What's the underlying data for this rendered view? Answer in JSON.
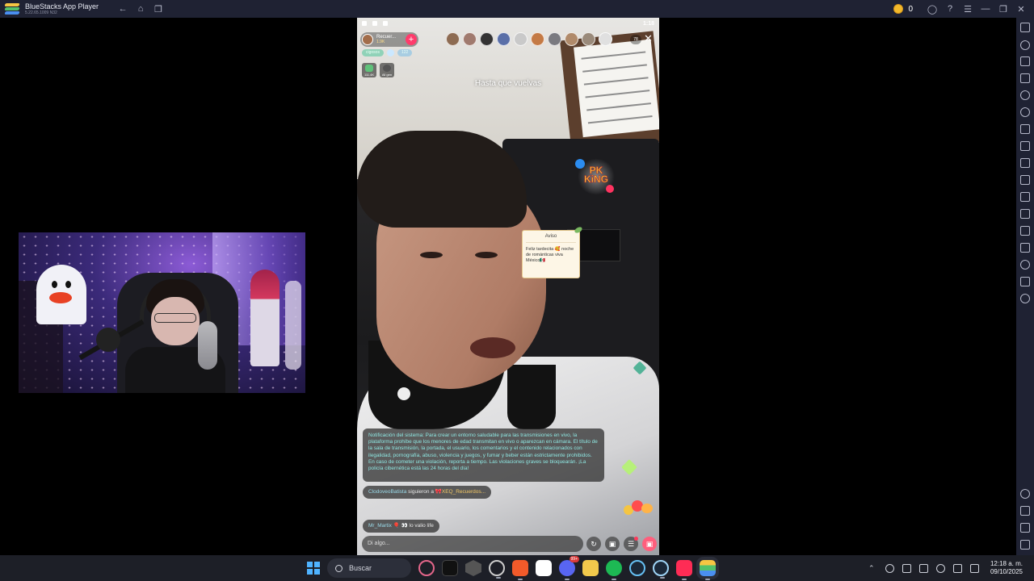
{
  "titlebar": {
    "app_title": "BlueStacks App Player",
    "version": "5.22.65.1009  N32",
    "coins": "0",
    "back_icon": "back-arrow-icon",
    "home_icon": "home-icon",
    "recents_icon": "recents-icon"
  },
  "stream": {
    "status_time": "1:18",
    "host_name": "Recuer...",
    "host_followers": "1.9K",
    "tag_primary": "cigosos",
    "tag_secondary": "122",
    "badge1_label": "111.4K",
    "badge2_label": "All gen",
    "viewer_count": "78",
    "song_title": "Hasta que vuelvas",
    "pk_king": "PK KiNG",
    "notice_title": "Aviso",
    "notice_body": "Feliz tardecita 🥰 noche de románticas viva México🇲🇽",
    "system_message": "Notificación del sistema: Para crear un entorno saludable para las transmisiones en vivo, la plataforma prohíbe que los menores de edad transmitan en vivo o aparezcan en cámara. El título de la sala de transmisión, la portada, el usuario, los comentarios y el contenido relacionados con ilegalidad, pornografía, abuso, violencia y juegos, y fumar y beber están estrictamente prohibidos. En caso de cometer una violación, reporta a tiempo. Las violaciones graves se bloquearán. ¡La policía cibernética está las 24 horas del día!",
    "follow_user": "ClodoveoBatista",
    "follow_text": " siguieron a ",
    "follow_target": "🎀XEQ_Recuerdos...",
    "chat_user": "Mr_Martix",
    "chat_text": " 🎈 👀 lo valio life",
    "input_placeholder": "Di algo..."
  },
  "taskbar": {
    "search_label": "Buscar",
    "notification_badge": "99+",
    "time": "12:18 a. m.",
    "date": "09/10/2025"
  },
  "colors": {
    "bluestacks_chrome": "#1f2233",
    "taskbar": "#1d1f27",
    "chat_cyan": "#8ee7e2",
    "gift_pink": "#ff5f7d"
  }
}
